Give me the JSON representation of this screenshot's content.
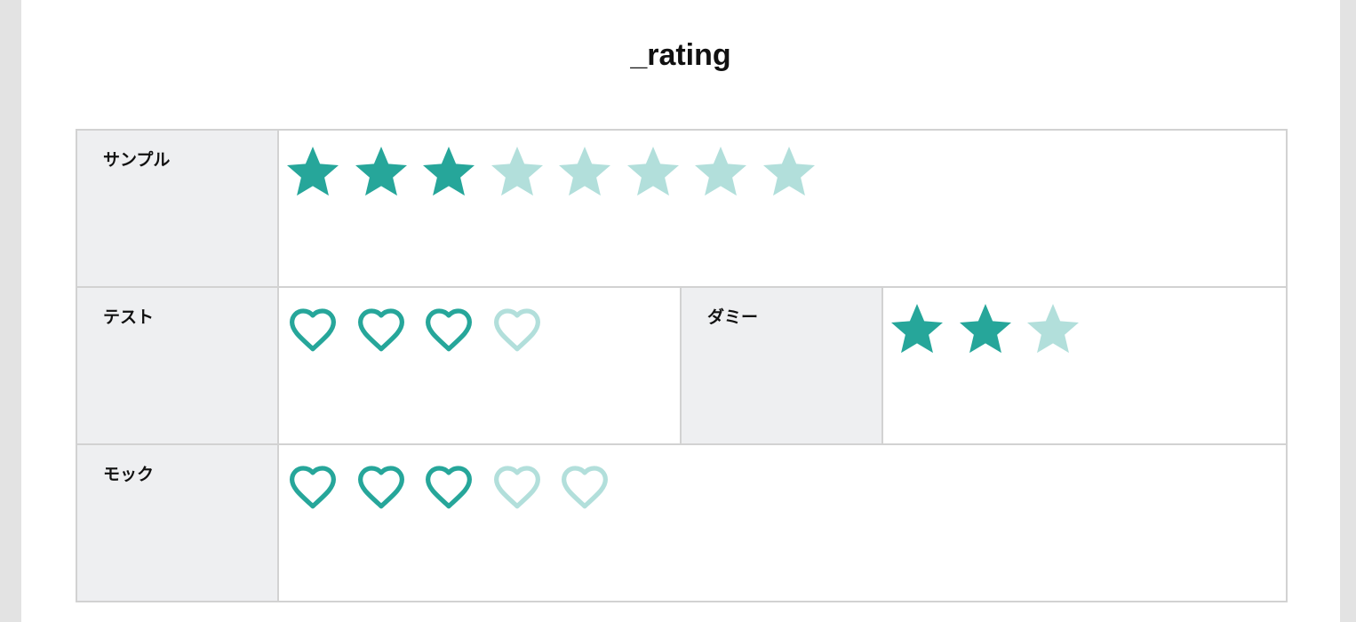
{
  "page": {
    "title": "_rating"
  },
  "colors": {
    "filled": "#26a69a",
    "empty": "#b2dfdb"
  },
  "rows": [
    {
      "label": "サンプル",
      "icon": "star-icon",
      "value": 3,
      "max": 8
    },
    {
      "label": "テスト",
      "icon": "heart-icon",
      "value": 3,
      "max": 4
    },
    {
      "label": "ダミー",
      "icon": "star-icon",
      "value": 2,
      "max": 3
    },
    {
      "label": "モック",
      "icon": "heart-icon",
      "value": 3,
      "max": 5
    }
  ]
}
